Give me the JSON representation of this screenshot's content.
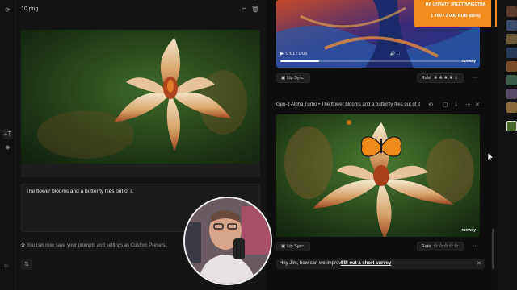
{
  "left_panel": {
    "file_name": "10.png",
    "prompt_text": "The flower blooms and a butterfly flies out of it",
    "tip_text": "You can now save your prompts and settings as Custom Presets.",
    "corner_label": "-16"
  },
  "feed": {
    "video1": {
      "time": "0:01 / 0:05",
      "progress": 0.2,
      "watermark": "runway"
    },
    "row1": {
      "lip_sync_label": "Lip Sync",
      "rate_label": "Rate",
      "stars_filled": 4,
      "stars_text": "★★★★☆"
    },
    "generation_title": "Gen-3 Alpha Turbo • The flower blooms and a butterfly flies out of it",
    "video2": {
      "watermark": "runway"
    },
    "row2": {
      "lip_sync_label": "Lip Sync",
      "rate_label": "Rate",
      "stars_filled": 0,
      "stars_text": "☆☆☆☆☆"
    }
  },
  "credits": {
    "label": "НА ОПЛАТУ ЭЛЕКТРИЧЕСТВА",
    "value": "1 700 / 2 000 RUB (85%)",
    "accent": "#f28b1e"
  },
  "survey": {
    "question": "Hey Jim, how can we improve?",
    "link": "Fill out a short survey"
  },
  "icons": {
    "rail": [
      "plus-icon",
      "text-icon",
      "layers-icon"
    ],
    "header": [
      "crop-icon",
      "trash-icon"
    ],
    "title_actions": [
      "refresh-icon",
      "folder-icon",
      "download-icon",
      "more-icon",
      "close-icon"
    ]
  }
}
